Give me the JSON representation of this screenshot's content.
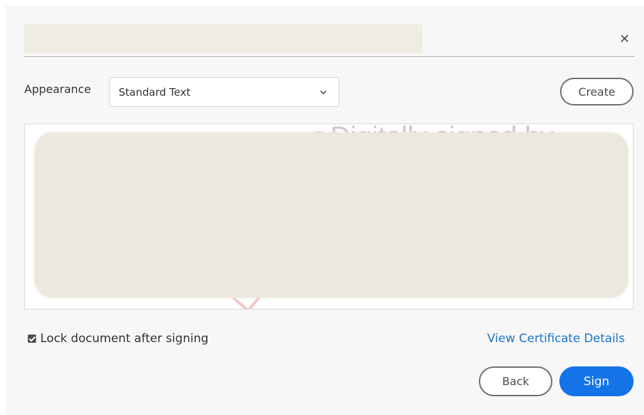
{
  "dialog": {
    "close_glyph": "✕"
  },
  "appearance": {
    "label": "Appearance",
    "selected": "Standard Text"
  },
  "buttons": {
    "create": "Create",
    "back": "Back",
    "sign": "Sign"
  },
  "preview": {
    "partial_text": "Digitally signed by "
  },
  "options": {
    "lock_label": "Lock document after signing",
    "lock_checked": true,
    "certificate_link": "View Certificate Details"
  },
  "colors": {
    "primary": "#1473e6",
    "link": "#1a73c8",
    "redaction": "#ece8df"
  }
}
